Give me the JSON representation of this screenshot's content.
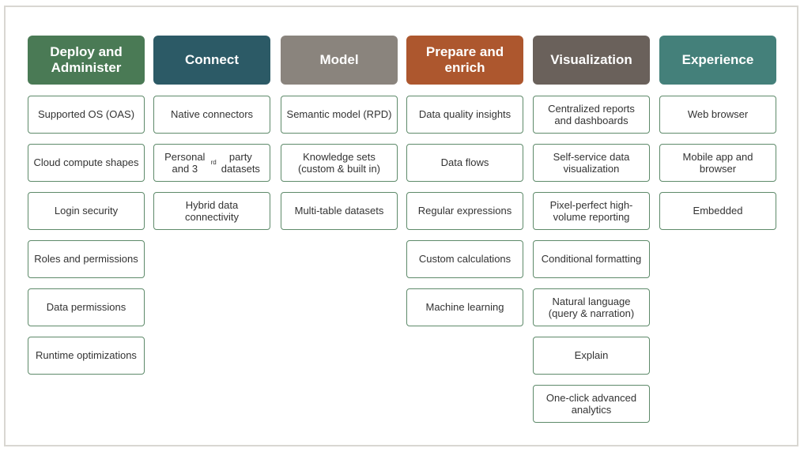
{
  "columns": [
    {
      "title": "Deploy and Administer",
      "color": "#4a7a55",
      "items": [
        "Supported OS (OAS)",
        "Cloud compute shapes",
        "Login security",
        "Roles and permissions",
        "Data permissions",
        "Runtime optimizations"
      ]
    },
    {
      "title": "Connect",
      "color": "#2c5a66",
      "items": [
        "Native connectors",
        "Personal and 3rd party datasets",
        "Hybrid data connectivity"
      ]
    },
    {
      "title": "Model",
      "color": "#8a847d",
      "items": [
        "Semantic model (RPD)",
        "Knowledge sets (custom & built in)",
        "Multi-table datasets"
      ]
    },
    {
      "title": "Prepare and enrich",
      "color": "#ad572e",
      "items": [
        "Data quality insights",
        "Data flows",
        "Regular expressions",
        "Custom calculations",
        "Machine learning"
      ]
    },
    {
      "title": "Visualization",
      "color": "#6a615b",
      "items": [
        "Centralized reports and dashboards",
        "Self-service data visualization",
        "Pixel-perfect high-volume reporting",
        "Conditional formatting",
        "Natural language (query & narration)",
        "Explain",
        "One-click advanced analytics"
      ]
    },
    {
      "title": "Experience",
      "color": "#44807a",
      "items": [
        "Web browser",
        "Mobile app and browser",
        "Embedded"
      ]
    }
  ]
}
